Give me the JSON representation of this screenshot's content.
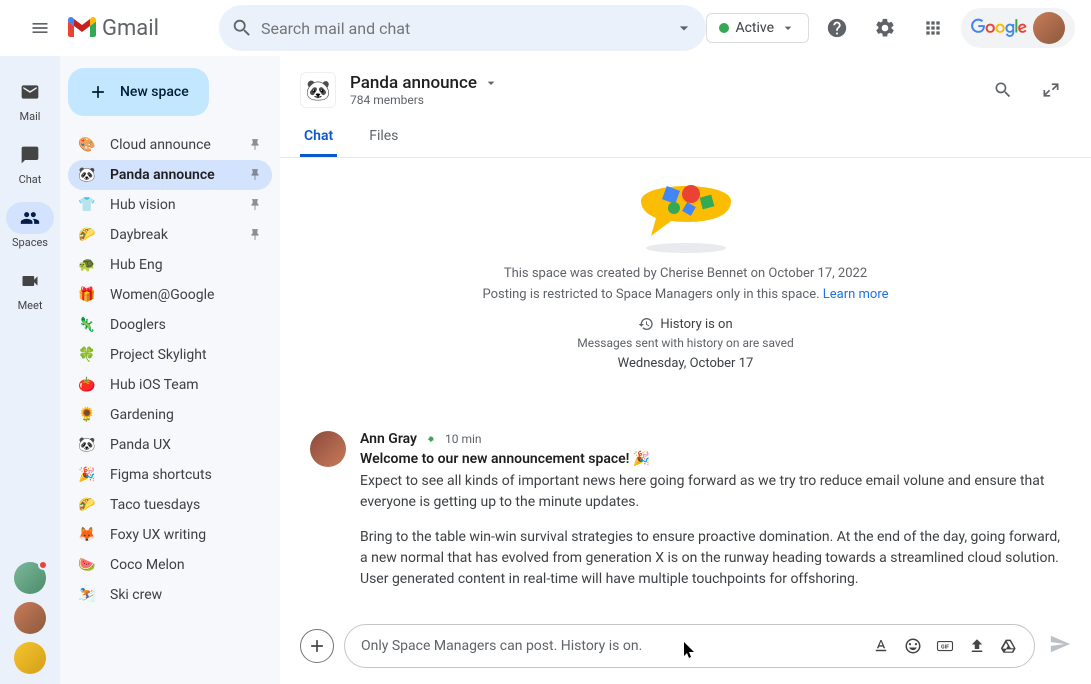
{
  "header": {
    "app_name": "Gmail",
    "search_placeholder": "Search mail and chat",
    "status_label": "Active",
    "google_label": "Google"
  },
  "rail": {
    "items": [
      {
        "label": "Mail"
      },
      {
        "label": "Chat"
      },
      {
        "label": "Spaces"
      },
      {
        "label": "Meet"
      }
    ]
  },
  "sidebar": {
    "new_space_label": "New space",
    "items": [
      {
        "emoji": "🎨",
        "name": "Cloud announce",
        "pinned": true
      },
      {
        "emoji": "🐼",
        "name": "Panda announce",
        "pinned": true
      },
      {
        "emoji": "👕",
        "name": "Hub vision",
        "pinned": true
      },
      {
        "emoji": "🌮",
        "name": "Daybreak",
        "pinned": true
      },
      {
        "emoji": "🐢",
        "name": "Hub Eng",
        "pinned": false
      },
      {
        "emoji": "🎁",
        "name": "Women@Google",
        "pinned": false
      },
      {
        "emoji": "🦎",
        "name": "Dooglers",
        "pinned": false
      },
      {
        "emoji": "🍀",
        "name": "Project Skylight",
        "pinned": false
      },
      {
        "emoji": "🍅",
        "name": "Hub iOS Team",
        "pinned": false
      },
      {
        "emoji": "🌻",
        "name": "Gardening",
        "pinned": false
      },
      {
        "emoji": "🐼",
        "name": "Panda UX",
        "pinned": false
      },
      {
        "emoji": "🎉",
        "name": "Figma shortcuts",
        "pinned": false
      },
      {
        "emoji": "🌮",
        "name": "Taco tuesdays",
        "pinned": false
      },
      {
        "emoji": "🦊",
        "name": "Foxy UX writing",
        "pinned": false
      },
      {
        "emoji": "🍉",
        "name": "Coco Melon",
        "pinned": false
      },
      {
        "emoji": "⛷️",
        "name": "Ski crew",
        "pinned": false
      }
    ]
  },
  "space": {
    "emoji": "🐼",
    "title": "Panda announce",
    "members": "784 members",
    "tabs": {
      "chat": "Chat",
      "files": "Files"
    },
    "created_text": "This space was created by Cherise Bennet on October 17, 2022",
    "restricted_text": "Posting is restricted to Space Managers only in this space.",
    "learn_more": "Learn more",
    "history_label": "History is on",
    "history_sub": "Messages sent with history on are saved",
    "date_label": "Wednesday, October 17"
  },
  "message": {
    "author": "Ann Gray",
    "time": "10 min",
    "welcome": "Welcome to our new announcement space! 🎉",
    "body1": "Expect to see all kinds of important news here going forward as we try tro reduce email volune and ensure that everyone is getting up to the minute updates.",
    "body2": "Bring to the table win-win survival strategies to ensure proactive domination. At the end of the day, going forward, a new normal that has evolved from generation X is on the runway heading towards a streamlined cloud solution. User generated content in real-time will have multiple touchpoints for offshoring."
  },
  "compose": {
    "placeholder": "Only Space Managers can post. History is on."
  }
}
